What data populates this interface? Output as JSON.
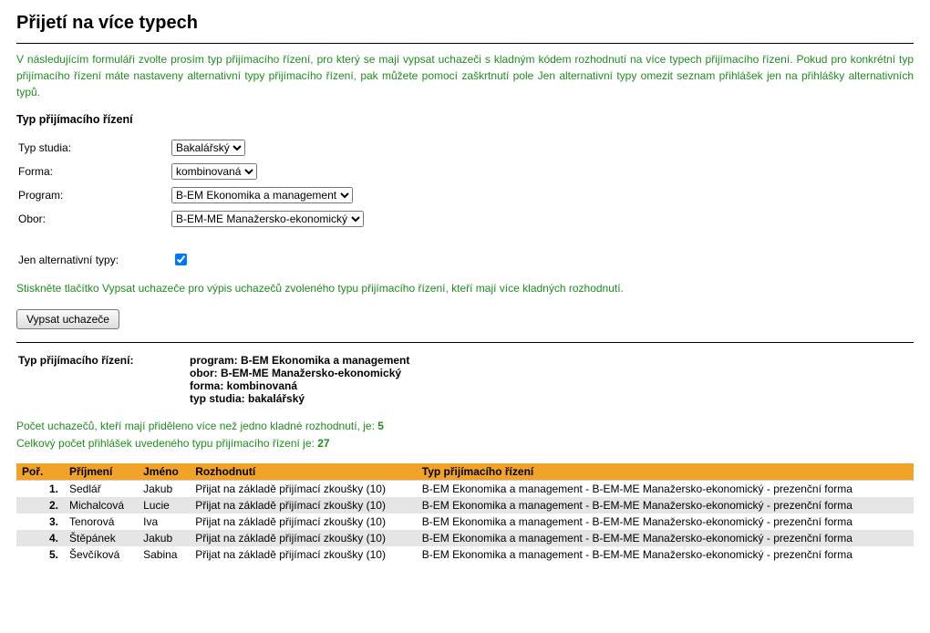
{
  "title": "Přijetí na více typech",
  "intro": "V následujícím formuláři zvolte prosím typ přijímacího řízení, pro který se mají vypsat uchazeči s kladným kódem rozhodnutí na více typech přijímacího řízení. Pokud pro konkrétní typ přijímacího řízení máte nastaveny alternativní typy přijímacího řízení, pak můžete pomocí zaškrtnutí pole Jen alternativní typy omezit seznam přihlášek jen na přihlášky alternativních typů.",
  "form": {
    "heading": "Typ přijímacího řízení",
    "typ_studia_label": "Typ studia:",
    "typ_studia_value": "Bakalářský",
    "forma_label": "Forma:",
    "forma_value": "kombinovaná",
    "program_label": "Program:",
    "program_value": "B-EM Ekonomika a management",
    "obor_label": "Obor:",
    "obor_value": "B-EM-ME Manažersko-ekonomický",
    "alt_label": "Jen alternativní typy:",
    "alt_checked": true
  },
  "hint": "Stiskněte tlačítko Vypsat uchazeče pro výpis uchazečů zvoleného typu přijímacího řízení, kteří mají více kladných rozhodnutí.",
  "submit_label": "Vypsat uchazeče",
  "summary": {
    "row_label": "Typ přijímacího řízení:",
    "program": "program: B-EM Ekonomika a management",
    "obor": "obor: B-EM-ME Manažersko-ekonomický",
    "forma": "forma: kombinovaná",
    "typ": "typ studia: bakalářský"
  },
  "counts": {
    "line1_text": "Počet uchazečů, kteří mají přiděleno více než jedno kladné rozhodnutí, je: ",
    "line1_num": "5",
    "line2_text": "Celkový počet přihlášek uvedeného typu přijímacího řízení je: ",
    "line2_num": "27"
  },
  "table": {
    "headers": {
      "por": "Poř.",
      "prijmeni": "Příjmení",
      "jmeno": "Jméno",
      "rozhodnuti": "Rozhodnutí",
      "typ": "Typ přijímacího řízení"
    },
    "rows": [
      {
        "por": "1.",
        "prijmeni": "Sedlář",
        "jmeno": "Jakub",
        "rozhodnuti": "Přijat na základě přijímací zkoušky (10)",
        "typ": "B-EM Ekonomika a management - B-EM-ME Manažersko-ekonomický - prezenční forma"
      },
      {
        "por": "2.",
        "prijmeni": "Michalcová",
        "jmeno": "Lucie",
        "rozhodnuti": "Přijat na základě přijímací zkoušky (10)",
        "typ": "B-EM Ekonomika a management - B-EM-ME Manažersko-ekonomický - prezenční forma"
      },
      {
        "por": "3.",
        "prijmeni": "Tenorová",
        "jmeno": "Iva",
        "rozhodnuti": "Přijat na základě přijímací zkoušky (10)",
        "typ": "B-EM Ekonomika a management - B-EM-ME Manažersko-ekonomický - prezenční forma"
      },
      {
        "por": "4.",
        "prijmeni": "Štěpánek",
        "jmeno": "Jakub",
        "rozhodnuti": "Přijat na základě přijímací zkoušky (10)",
        "typ": "B-EM Ekonomika a management - B-EM-ME Manažersko-ekonomický - prezenční forma"
      },
      {
        "por": "5.",
        "prijmeni": "Ševčíková",
        "jmeno": "Sabina",
        "rozhodnuti": "Přijat na základě přijímací zkoušky (10)",
        "typ": "B-EM Ekonomika a management - B-EM-ME Manažersko-ekonomický - prezenční forma"
      }
    ]
  }
}
